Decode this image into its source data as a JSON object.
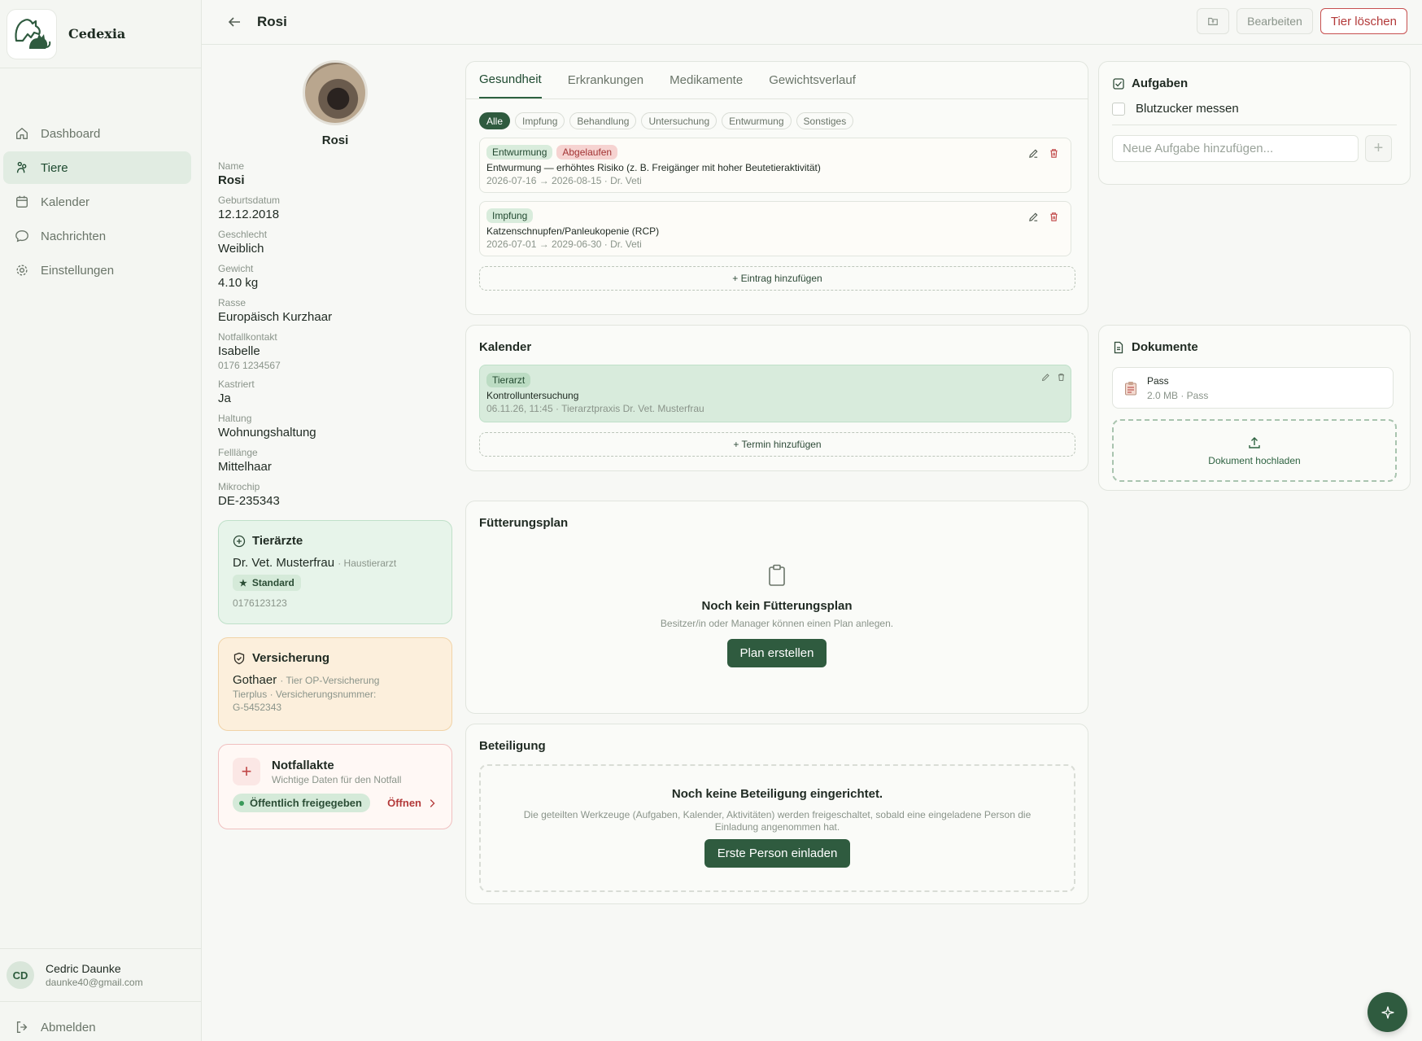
{
  "brand": {
    "name": "Cedexia"
  },
  "nav": {
    "items": [
      {
        "label": "Dashboard",
        "icon": "home-icon"
      },
      {
        "label": "Tiere",
        "icon": "paw-icon"
      },
      {
        "label": "Kalender",
        "icon": "calendar-icon"
      },
      {
        "label": "Nachrichten",
        "icon": "chat-icon"
      },
      {
        "label": "Einstellungen",
        "icon": "gear-icon"
      }
    ],
    "active": "Tiere"
  },
  "user": {
    "initials": "CD",
    "name": "Cedric Daunke",
    "email": "daunke40@gmail.com"
  },
  "logout_label": "Abmelden",
  "header": {
    "title": "Rosi",
    "edit_label": "Bearbeiten",
    "delete_label": "Tier löschen"
  },
  "profile": {
    "name": "Rosi",
    "fields": [
      {
        "label": "Name",
        "value": "Rosi"
      },
      {
        "label": "Geburtsdatum",
        "value": "12.12.2018"
      },
      {
        "label": "Geschlecht",
        "value": "Weiblich"
      },
      {
        "label": "Gewicht",
        "value": "4.10 kg"
      },
      {
        "label": "Rasse",
        "value": "Europäisch Kurzhaar"
      },
      {
        "label": "Notfallkontakt",
        "value": "Isabelle",
        "sub": "0176 1234567"
      },
      {
        "label": "Kastriert",
        "value": "Ja"
      },
      {
        "label": "Haltung",
        "value": "Wohnungshaltung"
      },
      {
        "label": "Felllänge",
        "value": "Mittelhaar"
      },
      {
        "label": "Mikrochip",
        "value": "DE-235343"
      }
    ]
  },
  "vets": {
    "title": "Tierärzte",
    "name": "Dr. Vet. Musterfrau",
    "role": "· Haustierarzt",
    "badge": "Standard",
    "phone": "0176123123"
  },
  "insurance": {
    "title": "Versicherung",
    "company": "Gothaer",
    "type": "· Tier OP-Versicherung",
    "details_line1": "Tierplus · Versicherungsnummer:",
    "details_line2": "G-5452343"
  },
  "emergency": {
    "title": "Notfallakte",
    "subtitle": "Wichtige Daten für den Notfall",
    "status": "Öffentlich freigegeben",
    "open_label": "Öffnen"
  },
  "health": {
    "tabs": [
      "Gesundheit",
      "Erkrankungen",
      "Medikamente",
      "Gewichtsverlauf"
    ],
    "active_tab": "Gesundheit",
    "filters": [
      "Alle",
      "Impfung",
      "Behandlung",
      "Untersuchung",
      "Entwurmung",
      "Sonstiges"
    ],
    "active_filter": "Alle",
    "entries": [
      {
        "tags": [
          "Entwurmung",
          "Abgelaufen"
        ],
        "title": "Entwurmung — erhöhtes Risiko (z. B. Freigänger mit hoher Beutetieraktivität)",
        "meta": "2026-07-16 → 2026-08-15 · Dr. Veti"
      },
      {
        "tags": [
          "Impfung"
        ],
        "title": "Katzenschnupfen/Panleukopenie (RCP)",
        "meta": "2026-07-01 → 2029-06-30 · Dr. Veti"
      }
    ],
    "add_label": "+ Eintrag hinzufügen"
  },
  "calendar": {
    "title": "Kalender",
    "entry": {
      "tag": "Tierarzt",
      "title": "Kontrolluntersuchung",
      "meta": "06.11.26, 11:45 · Tierarztpraxis Dr. Vet. Musterfrau"
    },
    "add_label": "+ Termin hinzufügen"
  },
  "feeding": {
    "title": "Fütterungsplan",
    "empty_title": "Noch kein Fütterungsplan",
    "empty_sub": "Besitzer/in oder Manager können einen Plan anlegen.",
    "button": "Plan erstellen"
  },
  "sharing": {
    "title": "Beteiligung",
    "empty_title": "Noch keine Beteiligung eingerichtet.",
    "empty_sub_line1": "Die geteilten Werkzeuge (Aufgaben, Kalender, Aktivitäten) werden freigeschaltet, sobald eine eingeladene Person die",
    "empty_sub_line2": "Einladung angenommen hat.",
    "button": "Erste Person einladen"
  },
  "tasks": {
    "title": "Aufgaben",
    "items": [
      {
        "label": "Blutzucker messen",
        "done": false
      }
    ],
    "input_placeholder": "Neue Aufgabe hinzufügen..."
  },
  "documents": {
    "title": "Dokumente",
    "items": [
      {
        "name": "Pass",
        "meta": "2.0 MB · Pass"
      }
    ],
    "upload_label": "Dokument hochladen"
  },
  "colors": {
    "primary": "#2f5b3f",
    "danger": "#b33a3a",
    "vet_card": "#e7f4ea",
    "insurance_card": "#fcefdc"
  }
}
